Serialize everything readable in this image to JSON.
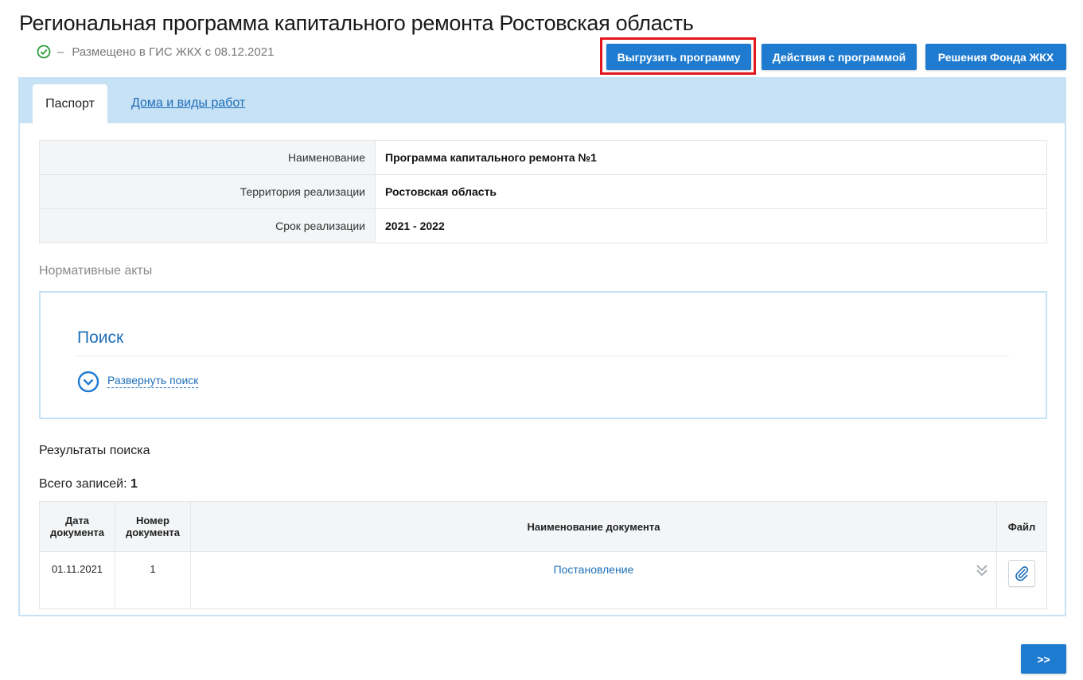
{
  "page": {
    "title": "Региональная программа капитального ремонта Ростовская область",
    "status_dash": "–",
    "status_text": "Размещено в ГИС ЖКХ с 08.12.2021"
  },
  "toolbar": {
    "export_label": "Выгрузить программу",
    "actions_label": "Действия с программой",
    "decisions_label": "Решения Фонда ЖКХ"
  },
  "tabs": [
    {
      "label": "Паспорт",
      "active": true
    },
    {
      "label": "Дома и виды работ",
      "active": false
    }
  ],
  "passport": {
    "rows": [
      {
        "key": "Наименование",
        "value": "Программа капитального ремонта №1"
      },
      {
        "key": "Территория реализации",
        "value": "Ростовская область"
      },
      {
        "key": "Срок реализации",
        "value": "2021 - 2022"
      }
    ]
  },
  "normative": {
    "section_label": "Нормативные акты",
    "search_title": "Поиск",
    "expand_label": "Развернуть поиск"
  },
  "results": {
    "title": "Результаты поиска",
    "total_label": "Всего записей:",
    "total_count": "1",
    "columns": {
      "date_line1": "Дата",
      "date_line2": "документа",
      "number_line1": "Номер",
      "number_line2": "документа",
      "name": "Наименование документа",
      "file": "Файл"
    },
    "rows": [
      {
        "date": "01.11.2021",
        "number": "1",
        "name": "Постановление"
      }
    ]
  },
  "pager": {
    "next_label": ">>"
  },
  "colors": {
    "accent": "#1e7bcf",
    "tabbar": "#c7e1f5",
    "highlight": "#e3151d",
    "success": "#2e9e3f"
  },
  "icons": {
    "status": "check-circle-icon",
    "expand": "chevron-down-circle-icon",
    "row_more": "double-chevron-down-icon",
    "file": "paperclip-icon"
  }
}
